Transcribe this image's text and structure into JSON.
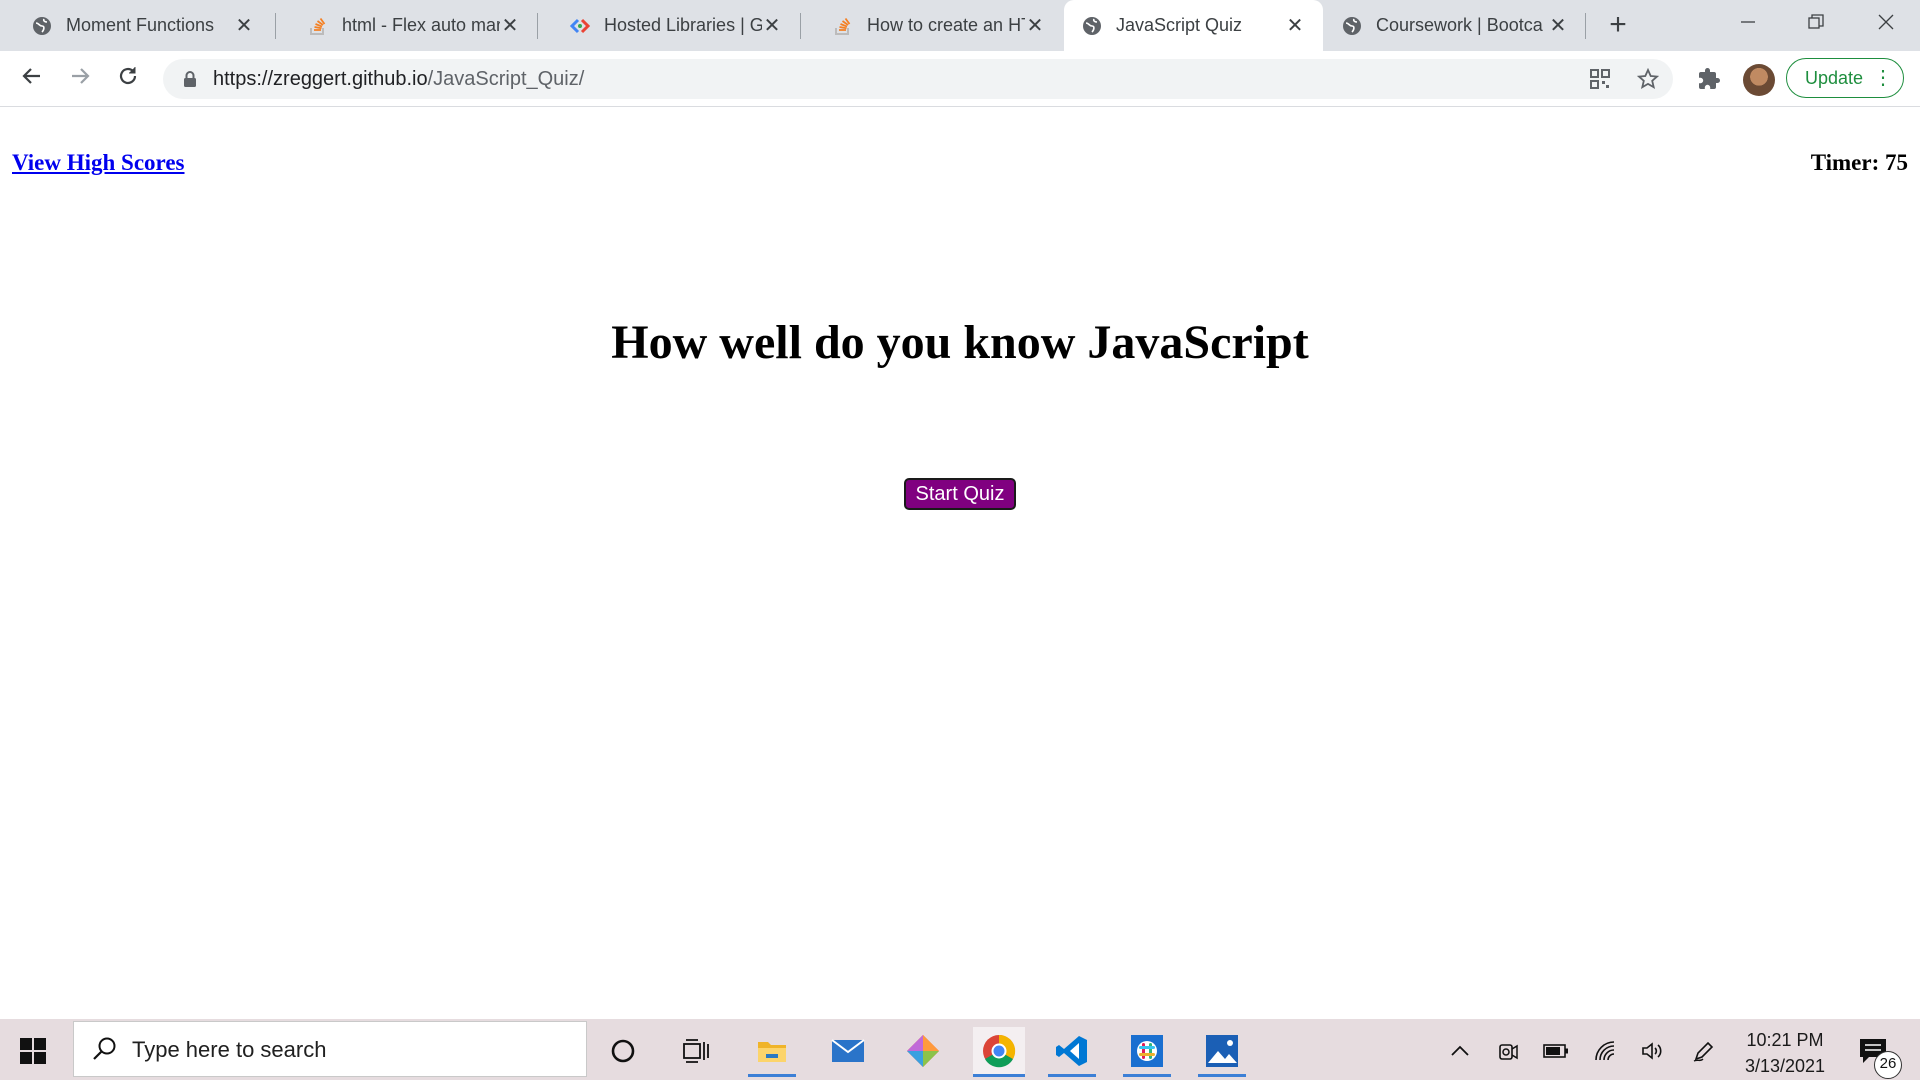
{
  "browser": {
    "tabs": [
      {
        "title": "Moment Functions",
        "favicon": "globe-icon"
      },
      {
        "title": "html - Flex auto mar",
        "favicon": "stackoverflow-icon"
      },
      {
        "title": "Hosted Libraries | G",
        "favicon": "google-developers-icon"
      },
      {
        "title": "How to create an HT",
        "favicon": "stackoverflow-icon"
      },
      {
        "title": "JavaScript Quiz",
        "favicon": "globe-icon",
        "active": true
      },
      {
        "title": "Coursework | Bootca",
        "favicon": "globe-icon"
      }
    ],
    "url_host": "https://zreggert.github.io",
    "url_path": "/JavaScript_Quiz/",
    "update_label": "Update"
  },
  "page": {
    "high_scores_link": "View High Scores",
    "timer_label": "Timer: 75",
    "heading": "How well do you know JavaScript",
    "start_button": "Start Quiz",
    "start_button_color": "#800080"
  },
  "taskbar": {
    "search_placeholder": "Type here to search",
    "time": "10:21 PM",
    "date": "3/13/2021",
    "notification_count": "26"
  }
}
